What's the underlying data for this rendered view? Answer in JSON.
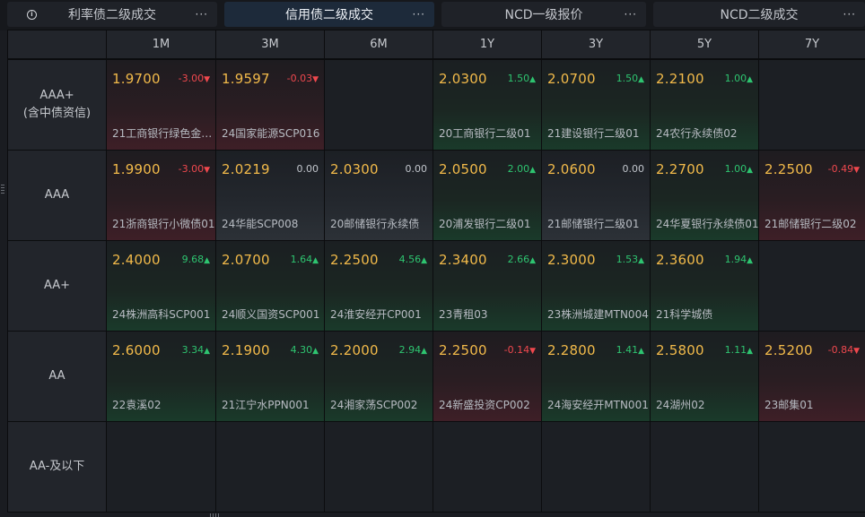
{
  "tabs": [
    {
      "label": "利率债二级成交",
      "more": "···"
    },
    {
      "label": "信用债二级成交",
      "more": "···"
    },
    {
      "label": "NCD一级报价",
      "more": "···"
    },
    {
      "label": "NCD二级成交",
      "more": "···"
    }
  ],
  "info_icon": "i",
  "columns": [
    "1M",
    "3M",
    "6M",
    "1Y",
    "3Y",
    "5Y",
    "7Y"
  ],
  "rows": [
    {
      "label": "AAA+",
      "sublabel": "(含中债资信)",
      "cells": [
        {
          "yield": "1.9700",
          "change": "-3.00",
          "dir": "down",
          "bond": "21工商银行绿色金…"
        },
        {
          "yield": "1.9597",
          "change": "-0.03",
          "dir": "down",
          "bond": "24国家能源SCP016"
        },
        null,
        {
          "yield": "2.0300",
          "change": "1.50",
          "dir": "up",
          "bond": "20工商银行二级01"
        },
        {
          "yield": "2.0700",
          "change": "1.50",
          "dir": "up",
          "bond": "21建设银行二级01"
        },
        {
          "yield": "2.2100",
          "change": "1.00",
          "dir": "up",
          "bond": "24农行永续债02"
        },
        null
      ]
    },
    {
      "label": "AAA",
      "sublabel": "",
      "cells": [
        {
          "yield": "1.9900",
          "change": "-3.00",
          "dir": "down",
          "bond": "21浙商银行小微债01"
        },
        {
          "yield": "2.0219",
          "change": "0.00",
          "dir": "flat",
          "bond": "24华能SCP008"
        },
        {
          "yield": "2.0300",
          "change": "0.00",
          "dir": "flat",
          "bond": "20邮储银行永续债"
        },
        {
          "yield": "2.0500",
          "change": "2.00",
          "dir": "up",
          "bond": "20浦发银行二级01"
        },
        {
          "yield": "2.0600",
          "change": "0.00",
          "dir": "flat",
          "bond": "21邮储银行二级01"
        },
        {
          "yield": "2.2700",
          "change": "1.00",
          "dir": "up",
          "bond": "24华夏银行永续债01"
        },
        {
          "yield": "2.2500",
          "change": "-0.49",
          "dir": "down",
          "bond": "21邮储银行二级02"
        }
      ]
    },
    {
      "label": "AA+",
      "sublabel": "",
      "cells": [
        {
          "yield": "2.4000",
          "change": "9.68",
          "dir": "up",
          "bond": "24株洲高科SCP001"
        },
        {
          "yield": "2.0700",
          "change": "1.64",
          "dir": "up",
          "bond": "24顺义国资SCP001"
        },
        {
          "yield": "2.2500",
          "change": "4.56",
          "dir": "up",
          "bond": "24淮安经开CP001"
        },
        {
          "yield": "2.3400",
          "change": "2.66",
          "dir": "up",
          "bond": "23青租03"
        },
        {
          "yield": "2.3000",
          "change": "1.53",
          "dir": "up",
          "bond": "23株洲城建MTN004"
        },
        {
          "yield": "2.3600",
          "change": "1.94",
          "dir": "up",
          "bond": "21科学城债"
        },
        null
      ]
    },
    {
      "label": "AA",
      "sublabel": "",
      "cells": [
        {
          "yield": "2.6000",
          "change": "3.34",
          "dir": "up",
          "bond": "22袁溪02"
        },
        {
          "yield": "2.1900",
          "change": "4.30",
          "dir": "up",
          "bond": "21江宁水PPN001"
        },
        {
          "yield": "2.2000",
          "change": "2.94",
          "dir": "up",
          "bond": "24湘家荡SCP002"
        },
        {
          "yield": "2.2500",
          "change": "-0.14",
          "dir": "down",
          "bond": "24新盛投资CP002"
        },
        {
          "yield": "2.2800",
          "change": "1.41",
          "dir": "up",
          "bond": "24海安经开MTN001"
        },
        {
          "yield": "2.5800",
          "change": "1.11",
          "dir": "up",
          "bond": "24湖州02"
        },
        {
          "yield": "2.5200",
          "change": "-0.84",
          "dir": "down",
          "bond": "23邮集01"
        }
      ]
    },
    {
      "label": "AA-及以下",
      "sublabel": "",
      "cells": [
        null,
        null,
        null,
        null,
        null,
        null,
        null
      ]
    }
  ],
  "colors": {
    "yield": "#f2ba4a",
    "up": "#2ec470",
    "down": "#f0484e",
    "active_tab": "#1d2a3a"
  },
  "active_tab_index": 1
}
